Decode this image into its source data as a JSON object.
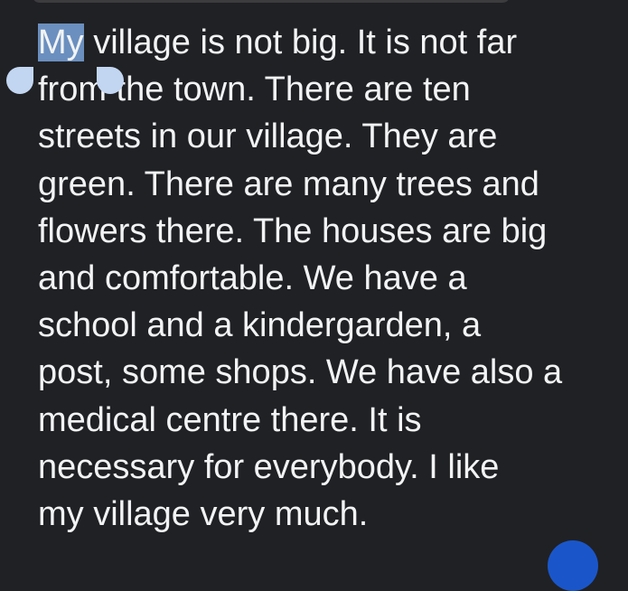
{
  "text": {
    "selected_word": "My",
    "line_1_rest": " village is not big. It is not far",
    "lines": [
      "from the town. There are ten",
      "streets in our village. They are",
      "green. There are many trees and",
      "flowers there. The houses are big",
      "and comfortable. We have a",
      "school and a kindergarden, a",
      "post, some shops. We have also a",
      "medical centre there. It is",
      "necessary for everybody. I like",
      "my village very much."
    ]
  },
  "colors": {
    "background": "#202124",
    "text": "#f1f3f4",
    "selection": "#6b8fbf",
    "selection_handle": "#c2d6f2"
  }
}
